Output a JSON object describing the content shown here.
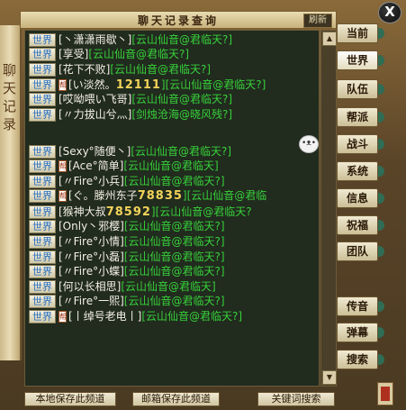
{
  "window": {
    "title": "聊天记录查询",
    "refresh_label": "刷新",
    "close_label": "X",
    "side_text": "聊天记录"
  },
  "messages": [
    {
      "tag": "世界",
      "guild": false,
      "name": "[丶潇潇雨歇丶]",
      "big": "",
      "channel": "[云山仙音@君临天?]"
    },
    {
      "tag": "世界",
      "guild": false,
      "name": "[享受]",
      "big": "",
      "channel": "[云山仙音@君临天?]"
    },
    {
      "tag": "世界",
      "guild": false,
      "name": "[花下不败]",
      "big": "",
      "channel": "[云山仙音@君临天?]"
    },
    {
      "tag": "世界",
      "guild": true,
      "name": "[い淡然。",
      "big": "12111",
      "channel": "][云山仙音@君临天?]"
    },
    {
      "tag": "世界",
      "guild": false,
      "name": "[哎呦喂い飞哥]",
      "big": "",
      "channel": "[云山仙音@君临天?]"
    },
    {
      "tag": "世界",
      "guild": false,
      "name": "[〃力拔山兮灬]",
      "big": "",
      "channel": "[剑烛沧海@晓风残?]"
    },
    {
      "tag": "世界",
      "guild": false,
      "name": "[Sexy°随便丶]",
      "big": "",
      "channel": "[云山仙音@君临天?]"
    },
    {
      "tag": "世界",
      "guild": true,
      "name": "[Ace°简单]",
      "big": "",
      "channel": "[云山仙音@君临天]"
    },
    {
      "tag": "世界",
      "guild": false,
      "name": "[〃Fire°小兵]",
      "big": "",
      "channel": "[云山仙音@君临天?]"
    },
    {
      "tag": "世界",
      "guild": true,
      "name": "[ぐ。滕州东子",
      "big": "78835",
      "channel": "][云山仙音@君临"
    },
    {
      "tag": "世界",
      "guild": false,
      "name": "[猴神大叔",
      "big": "78592",
      "channel": "][云山仙音@君临天?"
    },
    {
      "tag": "世界",
      "guild": false,
      "name": "[Only丶邪樱]",
      "big": "",
      "channel": "[云山仙音@君临天?]"
    },
    {
      "tag": "世界",
      "guild": false,
      "name": "[〃Fire°小情]",
      "big": "",
      "channel": "[云山仙音@君临天?]"
    },
    {
      "tag": "世界",
      "guild": false,
      "name": "[〃Fire°小磊]",
      "big": "",
      "channel": "[云山仙音@君临天?]"
    },
    {
      "tag": "世界",
      "guild": false,
      "name": "[〃Fire°小蝶]",
      "big": "",
      "channel": "[云山仙音@君临天?]"
    },
    {
      "tag": "世界",
      "guild": false,
      "name": "[何以长相思]",
      "big": "",
      "channel": "[云山仙音@君临天]"
    },
    {
      "tag": "世界",
      "guild": false,
      "name": "[〃Fire°一熙]",
      "big": "",
      "channel": "[云山仙音@君临天?]"
    },
    {
      "tag": "世界",
      "guild": true,
      "name": "[丨绰号老电丨]",
      "big": "",
      "channel": "[云山仙音@君临天?]"
    }
  ],
  "tabs": [
    "当前",
    "世界",
    "队伍",
    "帮派",
    "战斗",
    "系统",
    "信息",
    "祝福",
    "团队",
    "传音",
    "弹幕",
    "搜索"
  ],
  "active_tab": "世界",
  "bottom_buttons": {
    "local_save": "本地保存此频道",
    "mail_save": "邮箱保存此频道",
    "keyword_search": "关键词搜索"
  },
  "icons": {
    "scroll_up": "▲",
    "scroll_down": "▼",
    "avatar": "•ᴥ•",
    "guild_mark": "帮"
  },
  "colors": {
    "tag_text": "#2a6fc0",
    "channel": "#37d13a",
    "name": "#f4f0e4",
    "highlight": "#f2d35a"
  }
}
